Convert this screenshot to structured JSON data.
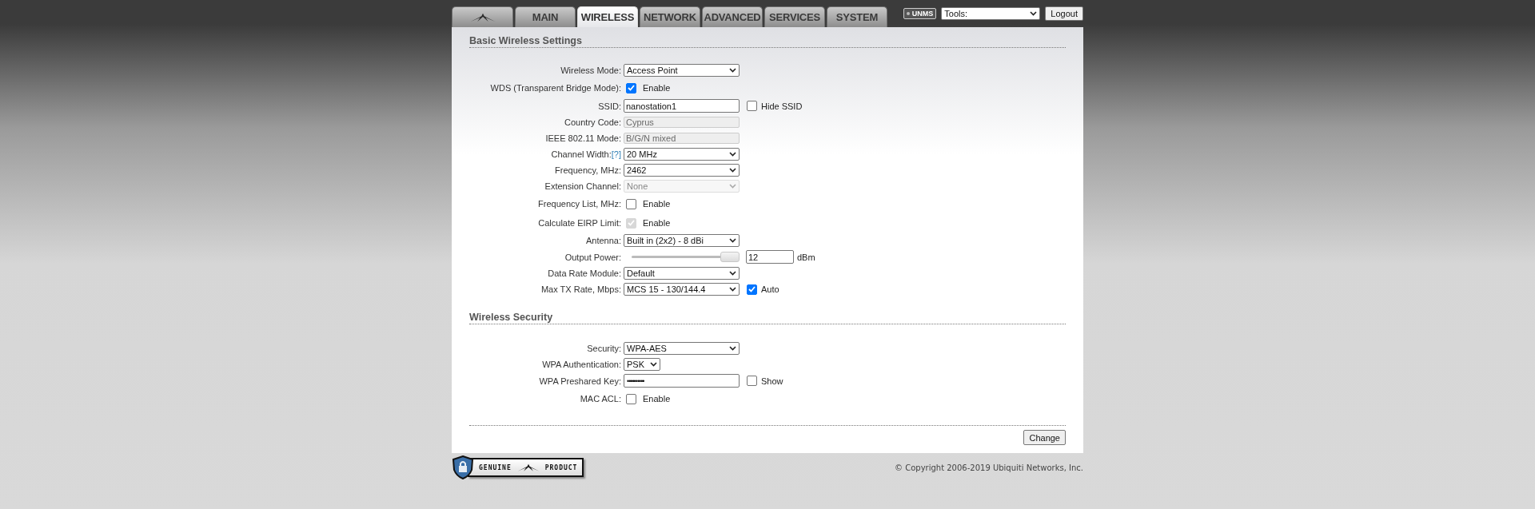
{
  "tabs": [
    {
      "kind": "logo",
      "selected": false
    },
    {
      "kind": "text",
      "label": "MAIN",
      "selected": false
    },
    {
      "kind": "text",
      "label": "WIRELESS",
      "selected": true
    },
    {
      "kind": "text",
      "label": "NETWORK",
      "selected": false
    },
    {
      "kind": "text",
      "label": "ADVANCED",
      "selected": false
    },
    {
      "kind": "text",
      "label": "SERVICES",
      "selected": false
    },
    {
      "kind": "text",
      "label": "SYSTEM",
      "selected": false
    }
  ],
  "toolbar": {
    "badge": "UNMS",
    "tools": "Tools:",
    "logout": "Logout"
  },
  "sections": [
    {
      "title": "Basic Wireless Settings",
      "rows": [
        {
          "label": "Wireless Mode:",
          "kind": "select",
          "value": "Access Point",
          "disabled": false
        },
        {
          "label": "WDS (Transparent Bridge Mode):",
          "kind": "checkbox",
          "text": "Enable",
          "checked": true,
          "disabled": false
        },
        {
          "label": "SSID:",
          "kind": "input",
          "value": "nanostation1",
          "disabled": false,
          "option": {
            "text": "Hide SSID",
            "checked": false
          }
        },
        {
          "label": "Country Code:",
          "kind": "input",
          "value": "Cyprus",
          "disabled": true
        },
        {
          "label": "IEEE 802.11 Mode:",
          "kind": "input",
          "value": "B/G/N mixed",
          "disabled": true
        },
        {
          "label": "Channel Width:",
          "help": "[?]",
          "kind": "select",
          "value": "20 MHz",
          "disabled": false
        },
        {
          "label": "Frequency, MHz:",
          "kind": "select",
          "value": "2462",
          "disabled": false
        },
        {
          "label": "Extension Channel:",
          "kind": "select",
          "value": "None",
          "disabled": true
        },
        {
          "label": "Frequency List, MHz:",
          "kind": "checkbox",
          "text": "Enable",
          "checked": false,
          "disabled": false
        },
        {
          "label": "Calculate EIRP Limit:",
          "kind": "checkbox",
          "text": "Enable",
          "checked": true,
          "disabled": true
        },
        {
          "label": "Antenna:",
          "kind": "select",
          "value": "Built in (2x2) - 8 dBi",
          "disabled": false
        },
        {
          "label": "Output Power:",
          "kind": "slider",
          "level": 1,
          "value": "12",
          "unit": "dBm"
        },
        {
          "label": "Data Rate Module:",
          "kind": "select",
          "value": "Default",
          "disabled": false
        },
        {
          "label": "Max TX Rate, Mbps:",
          "kind": "select",
          "value": "MCS 15 - 130/144.4",
          "disabled": false,
          "option": {
            "text": "Auto",
            "checked": true
          }
        }
      ]
    },
    {
      "title": "Wireless Security",
      "rows": [
        {
          "label": "Security:",
          "kind": "select",
          "value": "WPA-AES",
          "disabled": false
        },
        {
          "label": "WPA Authentication:",
          "kind": "short-select",
          "value": "PSK",
          "disabled": false
        },
        {
          "label": "WPA Preshared Key:",
          "kind": "password",
          "value": "••••••••••",
          "disabled": false,
          "option": {
            "text": "Show",
            "checked": false
          }
        },
        {
          "label": "MAC ACL:",
          "kind": "checkbox",
          "text": "Enable",
          "checked": false,
          "disabled": false
        }
      ]
    }
  ],
  "change_button": "Change",
  "footer": {
    "badge_left": "GENUINE",
    "badge_right": "PRODUCT",
    "copyright": "© Copyright 2006-2019 Ubiquiti Networks, Inc."
  }
}
